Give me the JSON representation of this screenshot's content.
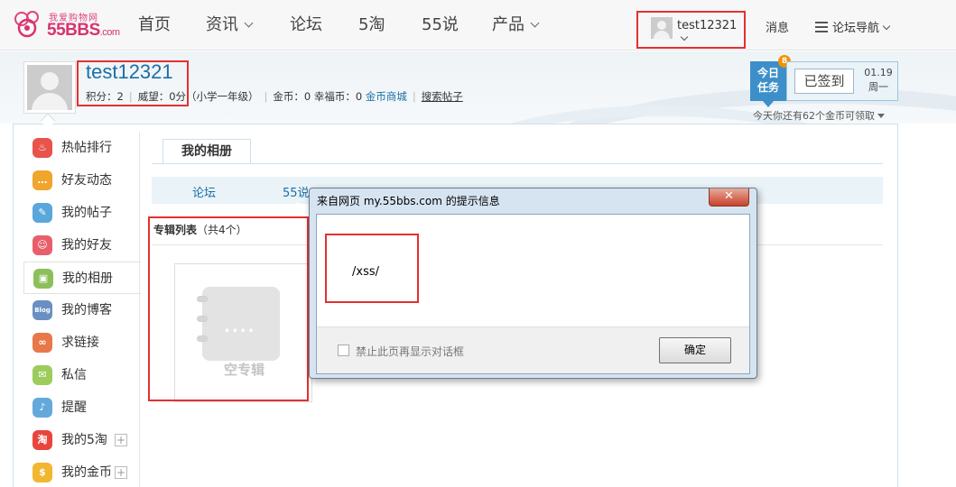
{
  "logo": {
    "sub": "我爱购物网",
    "main": "55BBS",
    "suffix": ".com"
  },
  "nav": [
    {
      "label": "首页",
      "dropdown": false
    },
    {
      "label": "资讯",
      "dropdown": true
    },
    {
      "label": "论坛",
      "dropdown": false
    },
    {
      "label": "5淘",
      "dropdown": false
    },
    {
      "label": "55说",
      "dropdown": false
    },
    {
      "label": "产品",
      "dropdown": true
    }
  ],
  "user_menu": {
    "name": "test12321"
  },
  "messages": "消息",
  "forum_nav": "论坛导航",
  "profile": {
    "name": "test12321",
    "points_label": "积分：",
    "points": "2",
    "prestige_label": "威望：",
    "prestige": "0分（小学一年级）",
    "gold_label": "金币：",
    "gold": "0",
    "happy_label": "幸福币：",
    "happy": "0",
    "mall_link": "金币商城",
    "search_link": "搜索帖子"
  },
  "task": {
    "label_line1": "今日",
    "label_line2": "任务",
    "count": "8"
  },
  "signin": {
    "button": "已签到",
    "date": "01.19",
    "weekday": "周一"
  },
  "coin_tip": "今天你还有62个金币可领取",
  "sidebar": [
    {
      "label": "热帖排行",
      "icon": "fire-icon",
      "glyph": "♨",
      "color": "#e8534a"
    },
    {
      "label": "好友动态",
      "icon": "chat-icon",
      "glyph": "…",
      "color": "#f0a52c"
    },
    {
      "label": "我的帖子",
      "icon": "edit-icon",
      "glyph": "✎",
      "color": "#5aa7db"
    },
    {
      "label": "我的好友",
      "icon": "friends-icon",
      "glyph": "☺",
      "color": "#e85f6c"
    },
    {
      "label": "我的相册",
      "icon": "photo-icon",
      "glyph": "▣",
      "color": "#8cbf5a"
    },
    {
      "label": "我的博客",
      "icon": "blog-icon",
      "glyph": "Blog",
      "color": "#6a8fc2"
    },
    {
      "label": "求链接",
      "icon": "link-icon",
      "glyph": "∞",
      "color": "#e8784a"
    },
    {
      "label": "私信",
      "icon": "mail-icon",
      "glyph": "✉",
      "color": "#9ccc5c"
    },
    {
      "label": "提醒",
      "icon": "bell-icon",
      "glyph": "♪",
      "color": "#63a9dc"
    },
    {
      "label": "我的5淘",
      "icon": "tao-icon",
      "glyph": "淘",
      "color": "#e8463c"
    },
    {
      "label": "我的金币",
      "icon": "coin-icon",
      "glyph": "$",
      "color": "#f2b730"
    }
  ],
  "album_tab": "我的相册",
  "subtabs": [
    "论坛",
    "55说"
  ],
  "album_list": {
    "title": "专辑列表",
    "count": "（共4个）"
  },
  "empty_album": "空专辑",
  "empty_album_dots": "....",
  "dialog": {
    "title": "来自网页 my.55bbs.com 的提示信息",
    "close": "✕",
    "message": "/xss/",
    "checkbox_label": "禁止此页再显示对话框",
    "ok": "确定"
  },
  "colors": {
    "accent": "#1b6fa6",
    "highlight": "#e43030",
    "brand": "#d8326f"
  }
}
